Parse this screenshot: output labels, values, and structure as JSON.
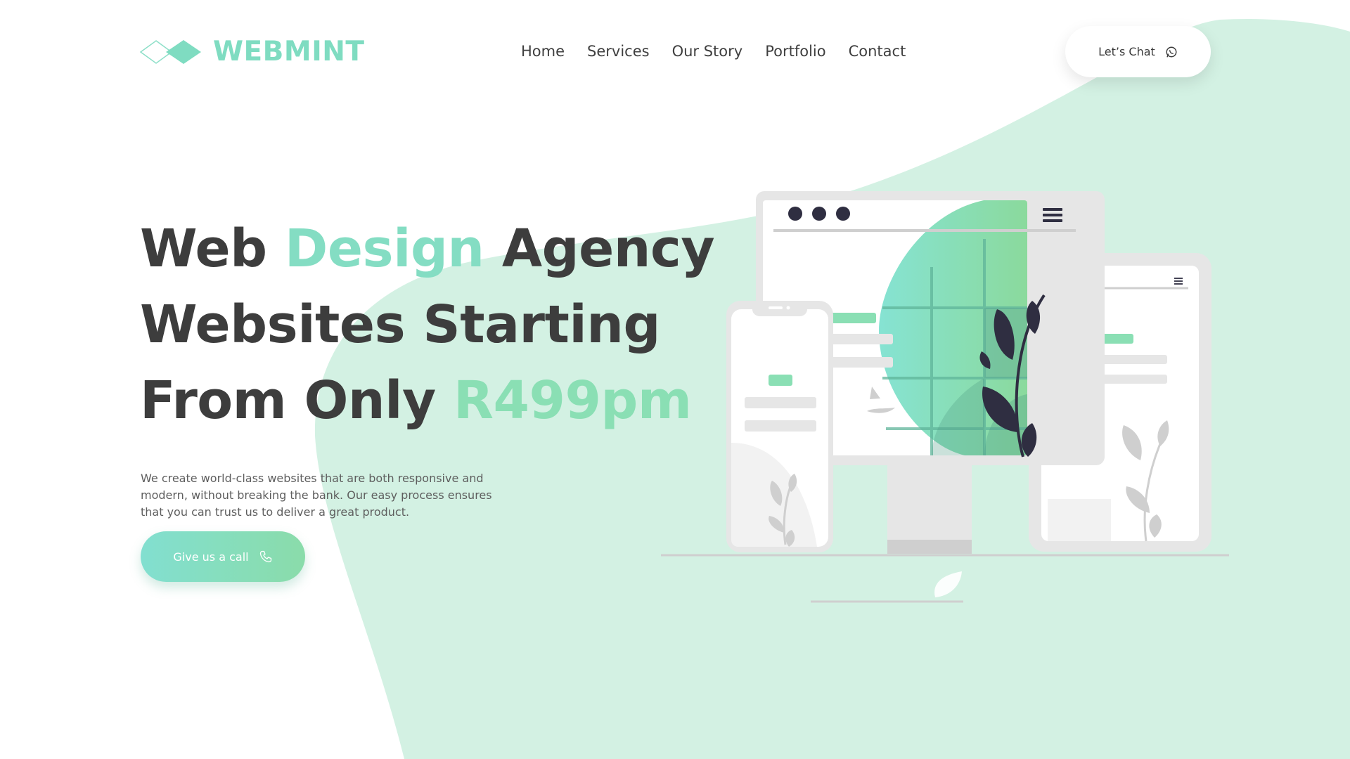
{
  "brand": {
    "name": "WEBMINT",
    "logo_icon": "diamond-logo-icon",
    "color": "#7fdcc1"
  },
  "nav": {
    "items": [
      {
        "label": "Home"
      },
      {
        "label": "Services"
      },
      {
        "label": "Our Story"
      },
      {
        "label": "Portfolio"
      },
      {
        "label": "Contact"
      }
    ]
  },
  "chat_button": {
    "label": "Let’s Chat",
    "icon": "whatsapp-icon"
  },
  "hero": {
    "line1": {
      "part1": "Web ",
      "accent": "Design",
      "part2": " Agency"
    },
    "line2": {
      "text": "Websites Starting"
    },
    "line3": {
      "part1": "From Only ",
      "accent": "R499pm"
    },
    "description": "We create world-class websites that are both responsive and modern, without breaking the bank. Our easy process ensures that you can trust us to deliver a great product."
  },
  "call_button": {
    "label": "Give us a call",
    "icon": "phone-icon"
  },
  "colors": {
    "accent": "#84ddc3",
    "accent_green": "#8adcaa",
    "background_mint": "#d3f1e3",
    "text_dark": "#3d3d3d",
    "illustration_dark": "#2f2e41"
  }
}
